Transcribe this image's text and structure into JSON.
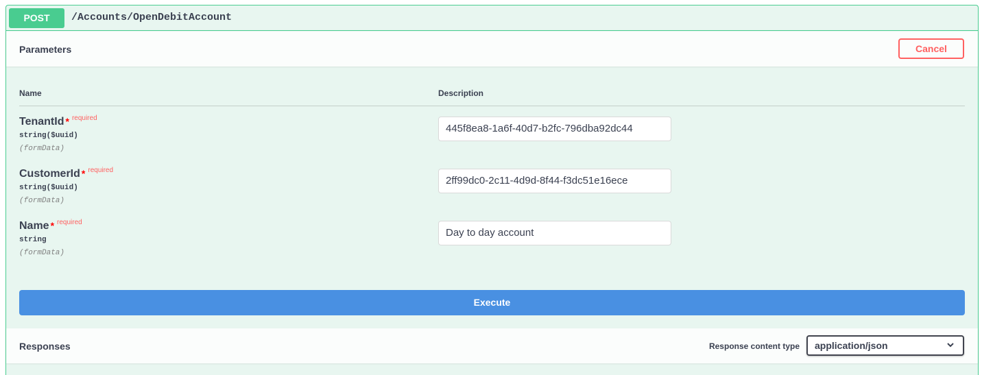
{
  "operation": {
    "method": "POST",
    "path": "/Accounts/OpenDebitAccount"
  },
  "parameters": {
    "title": "Parameters",
    "cancel_label": "Cancel",
    "columns": {
      "name": "Name",
      "description": "Description"
    },
    "required_label": "required",
    "items": [
      {
        "name": "TenantId",
        "type": "string($uuid)",
        "in": "(formData)",
        "value": "445f8ea8-1a6f-40d7-b2fc-796dba92dc44"
      },
      {
        "name": "CustomerId",
        "type": "string($uuid)",
        "in": "(formData)",
        "value": "2ff99dc0-2c11-4d9d-8f44-f3dc51e16ece"
      },
      {
        "name": "Name",
        "type": "string",
        "in": "(formData)",
        "value": "Day to day account"
      }
    ]
  },
  "execute_label": "Execute",
  "responses": {
    "title": "Responses",
    "content_type_label": "Response content type",
    "content_type_value": "application/json",
    "chevron_icon": "chevron-down-icon"
  },
  "colors": {
    "post_green": "#49cc90",
    "execute_blue": "#4990e2",
    "cancel_red": "#ff6060",
    "panel_bg": "#e8f6f0"
  }
}
